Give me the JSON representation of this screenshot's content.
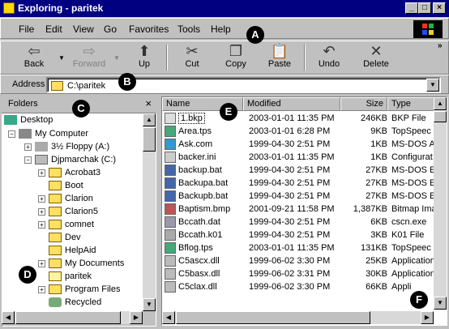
{
  "window": {
    "title": "Exploring - paritek"
  },
  "menu": {
    "items": [
      "File",
      "Edit",
      "View",
      "Go",
      "Favorites",
      "Tools",
      "Help"
    ]
  },
  "toolbar": {
    "back": "Back",
    "forward": "Forward",
    "up": "Up",
    "cut": "Cut",
    "copy": "Copy",
    "paste": "Paste",
    "undo": "Undo",
    "delete": "Delete"
  },
  "address": {
    "label": "Address",
    "value": "C:\\paritek"
  },
  "folders": {
    "title": "Folders",
    "close": "×",
    "tree": [
      {
        "label": "Desktop"
      },
      {
        "label": "My Computer"
      },
      {
        "label": "3½ Floppy (A:)"
      },
      {
        "label": "Djpmarchak (C:)"
      },
      {
        "label": "Acrobat3"
      },
      {
        "label": "Boot"
      },
      {
        "label": "Clarion"
      },
      {
        "label": "Clarion5"
      },
      {
        "label": "comnet"
      },
      {
        "label": "Dev"
      },
      {
        "label": "HelpAid"
      },
      {
        "label": "My Documents"
      },
      {
        "label": "paritek"
      },
      {
        "label": "Program Files"
      },
      {
        "label": "Recycled"
      }
    ]
  },
  "files": {
    "columns": [
      "Name",
      "Modified",
      "Size",
      "Type"
    ],
    "rows": [
      {
        "name": "1.bkp",
        "modified": "2003-01-01 11:35 PM",
        "size": "246KB",
        "type": "BKP File"
      },
      {
        "name": "Area.tps",
        "modified": "2003-01-01 6:28 PM",
        "size": "9KB",
        "type": "TopSpeec"
      },
      {
        "name": "Ask.com",
        "modified": "1999-04-30 2:51 PM",
        "size": "1KB",
        "type": "MS-DOS A"
      },
      {
        "name": "backer.ini",
        "modified": "2003-01-01 11:35 PM",
        "size": "1KB",
        "type": "Configurat"
      },
      {
        "name": "backup.bat",
        "modified": "1999-04-30 2:51 PM",
        "size": "27KB",
        "type": "MS-DOS E"
      },
      {
        "name": "Backupa.bat",
        "modified": "1999-04-30 2:51 PM",
        "size": "27KB",
        "type": "MS-DOS E"
      },
      {
        "name": "Backupb.bat",
        "modified": "1999-04-30 2:51 PM",
        "size": "27KB",
        "type": "MS-DOS E"
      },
      {
        "name": "Baptism.bmp",
        "modified": "2001-09-21 11:58 PM",
        "size": "1,387KB",
        "type": "Bitmap Ima"
      },
      {
        "name": "Bccath.dat",
        "modified": "1999-04-30 2:51 PM",
        "size": "6KB",
        "type": "cscn.exe"
      },
      {
        "name": "Bccath.k01",
        "modified": "1999-04-30 2:51 PM",
        "size": "3KB",
        "type": "K01 File"
      },
      {
        "name": "Bflog.tps",
        "modified": "2003-01-01 11:35 PM",
        "size": "131KB",
        "type": "TopSpeec"
      },
      {
        "name": "C5ascx.dll",
        "modified": "1999-06-02 3:30 PM",
        "size": "25KB",
        "type": "Application"
      },
      {
        "name": "C5basx.dll",
        "modified": "1999-06-02 3:31 PM",
        "size": "30KB",
        "type": "Application"
      },
      {
        "name": "C5clax.dll",
        "modified": "1999-06-02 3:30 PM",
        "size": "66KB",
        "type": "Appli"
      }
    ]
  },
  "callouts": [
    "A",
    "B",
    "C",
    "D",
    "E",
    "F"
  ],
  "colors": {
    "titlebar": "#000080",
    "window": "#c0c0c0",
    "folder": "#ffe060"
  },
  "icons": {
    "back": "left-arrow-icon",
    "forward": "right-arrow-icon",
    "up": "up-folder-icon",
    "cut": "scissors-icon",
    "copy": "copy-icon",
    "paste": "paste-icon",
    "undo": "undo-icon",
    "delete": "x-icon"
  }
}
